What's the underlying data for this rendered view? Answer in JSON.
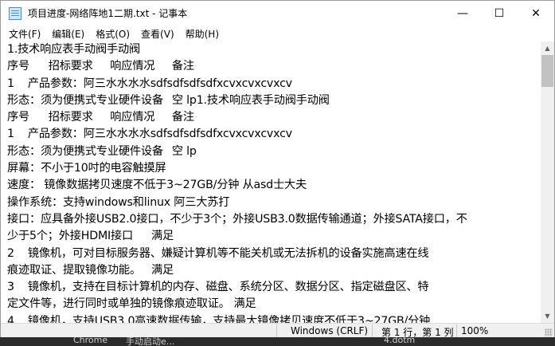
{
  "window": {
    "title": "项目进度-网络阵地1二期.txt - 记事本",
    "icon": "notepad-icon",
    "controls": {
      "minimize": "—",
      "maximize": "☐",
      "close": "✕"
    }
  },
  "menu": [
    {
      "label": "文件(F)"
    },
    {
      "label": "编辑(E)"
    },
    {
      "label": "格式(O)"
    },
    {
      "label": "查看(V)"
    },
    {
      "label": "帮助(H)"
    }
  ],
  "editor": {
    "lines": [
      "1.技术响应表手动阀手动阀",
      "序号\t招标要求\t响应情况\t备注",
      "1\t产品参数：阿三水水水水sdfsdfsdfsdfxcvxcvxcvxcv",
      "形态：须为便携式专业硬件设备\t空 lp1.技术响应表手动阀手动阀",
      "序号\t招标要求\t响应情况\t备注",
      "1\t产品参数：阿三水水水水sdfsdfsdfsdfxcvxcvxcvxcv",
      "形态：须为便携式专业硬件设备\t空 lp",
      "屏幕：不小于10吋的电容触摸屏",
      "速度： 镜像数据拷贝速度不低于3~27GB/分钟 从asd士大夫",
      "操作系统：支持windows和linux 阿三大苏打",
      "接口：应具备外接USB2.0接口，不少于3个；外接USB3.0数据传输通道；外接SATA接口，不",
      "少于5个；外接HDMI接口\t满足",
      "2\t镜像机，可对目标服务器、嫌疑计算机等不能关机或无法拆机的设备实施高速在线",
      "痕迹取证、提取镜像功能。\t满足",
      "3\t镜像机，支持在目标计算机的内存、磁盘、系统分区、数据分区、指定磁盘区、特",
      "定文件等，进行同时或单独的镜像痕迹取证。\t满足",
      "4\t镜像机，支持USB3.0高速数据传输，支持最大镜像拷贝速度不低于3~27GB/分钟"
    ]
  },
  "status": {
    "encoding": "Windows (CRLF)",
    "position": "第 1 行，第 1 列",
    "zoom": "100%"
  },
  "taskbar": {
    "items": [
      "Chrome",
      "手动启动e...",
      "4.dotm"
    ]
  }
}
